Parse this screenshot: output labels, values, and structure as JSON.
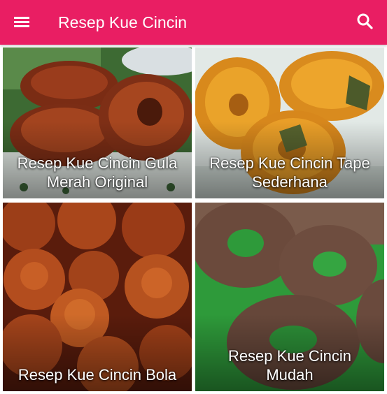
{
  "app_bar": {
    "title": "Resep Kue Cincin",
    "menu_icon": "hamburger-menu-icon",
    "search_icon": "search-icon",
    "background_color": "#e91e63"
  },
  "recipes": [
    {
      "caption_line1": "Resep Kue Cincin Gula",
      "caption_line2": "Merah Original"
    },
    {
      "caption_line1": "Resep Kue Cincin Tape",
      "caption_line2": "Sederhana"
    },
    {
      "caption_line1": "Resep Kue Cincin Bola",
      "caption_line2": ""
    },
    {
      "caption_line1": "Resep Kue Cincin",
      "caption_line2": "Mudah"
    }
  ]
}
